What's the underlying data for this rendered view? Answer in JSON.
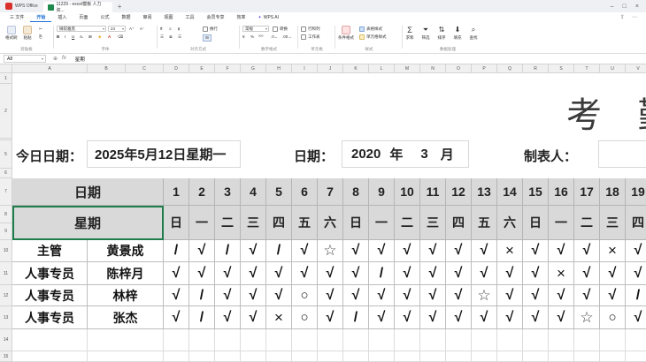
{
  "titlebar": {
    "home": "WPS Office",
    "tab_title": "11229 - excel模板 人力资...",
    "plus": "+"
  },
  "menu": {
    "items": [
      "三 文件",
      "开始",
      "插入",
      "页面",
      "公式",
      "数据",
      "审阅",
      "视图",
      "工具",
      "会员专享",
      "效率"
    ],
    "active": "开始",
    "ai": "WPS AI"
  },
  "ribbon": {
    "format_painter": "格式刷",
    "paste": "粘贴",
    "clipboard_label": "剪贴板",
    "font_name": "微软雅黑",
    "font_size": "24",
    "font_label": "字体",
    "wrap": "换行",
    "align_label": "对齐方式",
    "number_format": "常规",
    "convert": "转换",
    "number_label": "数字格式",
    "rows_cols": "行和列",
    "worksheet": "工作表",
    "cell_label": "单元格",
    "cond_format": "条件格式",
    "table_style": "表格样式",
    "cell_style": "单元格样式",
    "style_label": "样式",
    "sum": "求和",
    "filter": "筛选",
    "sort": "排序",
    "fill": "填充",
    "find": "查找",
    "data_label": "数据处理"
  },
  "formula_bar": {
    "cell_ref": "A8",
    "value": "星期"
  },
  "sheet": {
    "columns": [
      "A",
      "B",
      "C",
      "D",
      "E",
      "F",
      "G",
      "H",
      "I",
      "J",
      "K",
      "L",
      "M",
      "N",
      "O",
      "P",
      "Q",
      "R",
      "S",
      "T",
      "U",
      "V"
    ],
    "rows": [
      "1",
      "2",
      "3",
      "4",
      "5",
      "6",
      "7",
      "8",
      "9",
      "10",
      "11",
      "12",
      "13",
      "14",
      "15"
    ],
    "title": "考 勤",
    "today_label": "今日日期：",
    "today_value": "2025年5月12日星期一",
    "period_label": "日期：",
    "year": "2020",
    "year_unit": "年",
    "month": "3",
    "month_unit": "月",
    "maker_label": "制表人：",
    "date_header": "日期",
    "weekday_header": "星期",
    "days": [
      "1",
      "2",
      "3",
      "4",
      "5",
      "6",
      "7",
      "8",
      "9",
      "10",
      "11",
      "12",
      "13",
      "14",
      "15",
      "16",
      "17",
      "18",
      "19"
    ],
    "weekdays": [
      "日",
      "一",
      "二",
      "三",
      "四",
      "五",
      "六",
      "日",
      "一",
      "二",
      "三",
      "四",
      "五",
      "六",
      "日",
      "一",
      "二",
      "三",
      "四"
    ],
    "employees": [
      {
        "role": "主管",
        "name": "黄景成",
        "marks": [
          "/",
          "√",
          "/",
          "√",
          "/",
          "√",
          "☆",
          "√",
          "√",
          "√",
          "√",
          "√",
          "√",
          "×",
          "√",
          "√",
          "√",
          "×",
          "√"
        ]
      },
      {
        "role": "人事专员",
        "name": "陈梓月",
        "marks": [
          "√",
          "√",
          "√",
          "√",
          "√",
          "√",
          "√",
          "√",
          "/",
          "√",
          "√",
          "√",
          "√",
          "√",
          "√",
          "×",
          "√",
          "√",
          "√"
        ]
      },
      {
        "role": "人事专员",
        "name": "林梓",
        "marks": [
          "√",
          "/",
          "√",
          "√",
          "√",
          "○",
          "√",
          "√",
          "√",
          "√",
          "√",
          "√",
          "☆",
          "√",
          "√",
          "√",
          "√",
          "√",
          "/"
        ]
      },
      {
        "role": "人事专员",
        "name": "张杰",
        "marks": [
          "√",
          "/",
          "√",
          "√",
          "×",
          "○",
          "√",
          "/",
          "√",
          "√",
          "√",
          "√",
          "√",
          "√",
          "√",
          "√",
          "☆",
          "○",
          "√"
        ]
      }
    ]
  }
}
